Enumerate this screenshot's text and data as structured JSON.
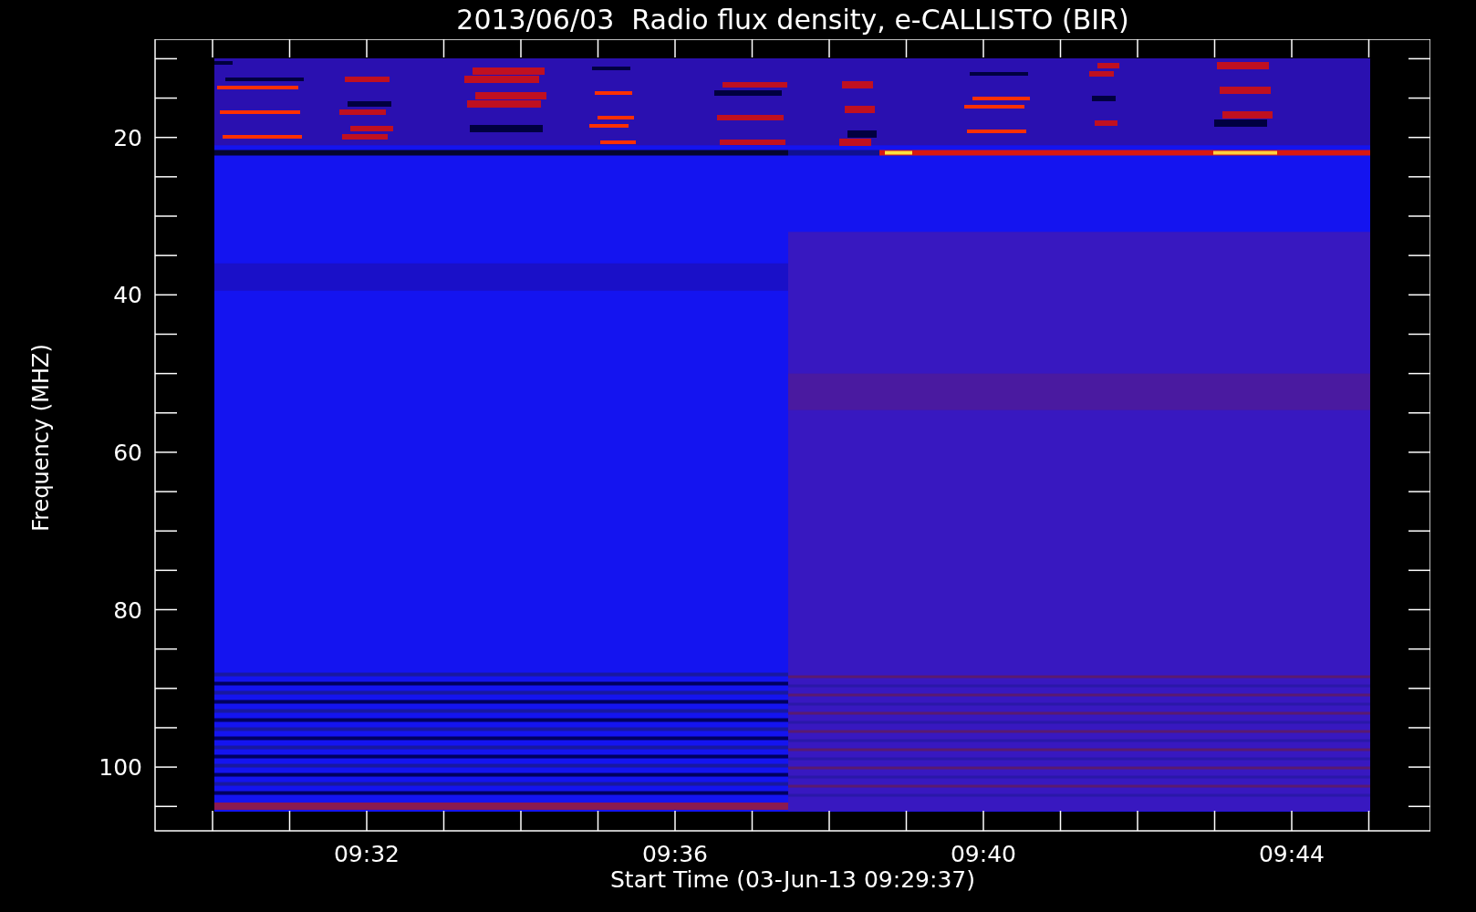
{
  "title": "2013/06/03  Radio flux density, e-CALLISTO (BIR)",
  "y_axis": {
    "label": "Frequency (MHZ)",
    "tick_labels": [
      "20",
      "40",
      "60",
      "80",
      "100"
    ]
  },
  "x_axis": {
    "label": "Start Time (03-Jun-13 09:29:37)",
    "tick_labels": [
      "09:32",
      "09:36",
      "09:40",
      "09:44"
    ]
  }
}
